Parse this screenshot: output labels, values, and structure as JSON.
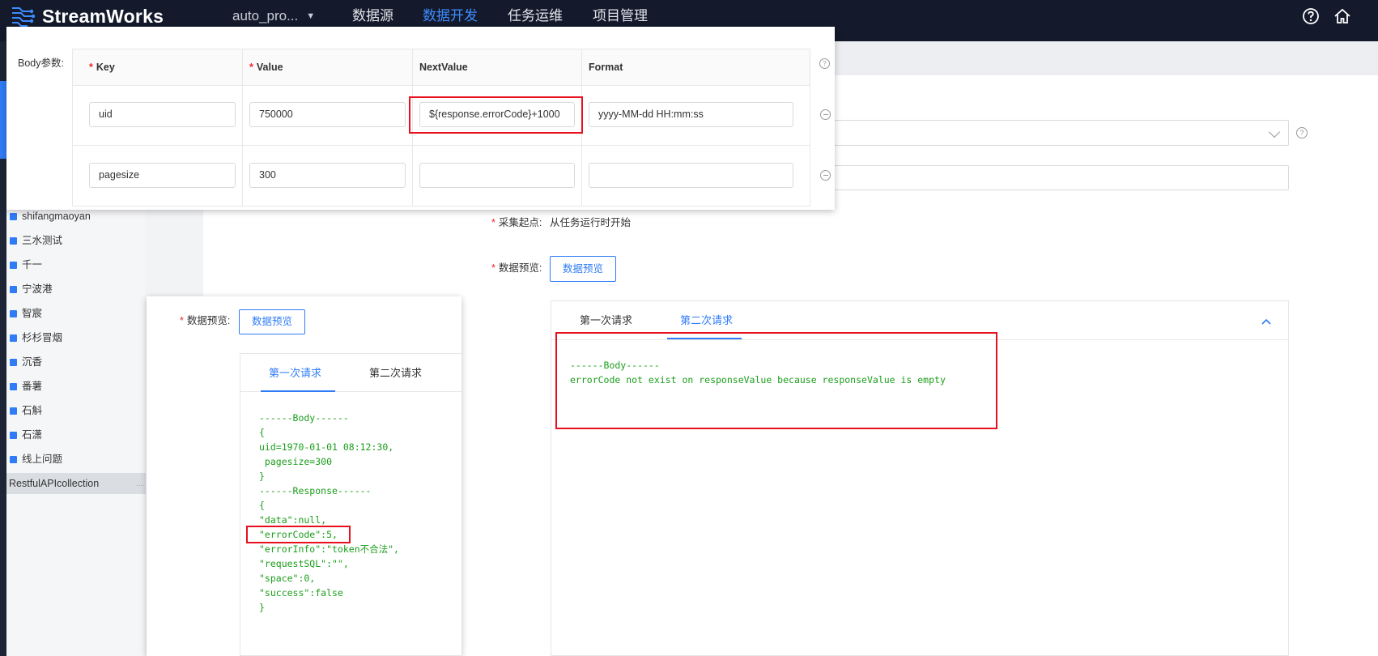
{
  "app": {
    "logo_text": "StreamWorks",
    "project": "auto_pro...",
    "nav": [
      "数据源",
      "数据开发",
      "任务运维",
      "项目管理"
    ],
    "active_nav": "数据开发"
  },
  "sidebar": {
    "items": [
      "shifangmaoyan",
      "三水测试",
      "千一",
      "宁波港",
      "智宸",
      "杉杉冒烟",
      "沉香",
      "番薯",
      "石斛",
      "石潇",
      "线上问题"
    ],
    "selected": "RestfulAPIcollection",
    "selected_more": "..."
  },
  "form": {
    "collect_start_label": "采集起点:",
    "collect_start_value": "从任务运行时开始",
    "preview_label": "数据预览:",
    "preview_button": "数据预览"
  },
  "right_preview": {
    "tabs": [
      "第一次请求",
      "第二次请求"
    ],
    "active_tab": 1,
    "lines": [
      "------Body------",
      "errorCode not exist on responseValue because responseValue is empty"
    ]
  },
  "left_preview": {
    "label": "数据预览:",
    "button": "数据预览",
    "tabs": [
      "第一次请求",
      "第二次请求"
    ],
    "active_tab": 0,
    "lines": [
      "------Body------",
      "{",
      "uid=1970-01-01 08:12:30,",
      " pagesize=300",
      "}",
      "------Response------",
      "{",
      "\"data\":null,",
      "\"errorCode\":5,",
      "\"errorInfo\":\"token不合法\",",
      "\"requestSQL\":\"\",",
      "\"space\":0,",
      "\"success\":false",
      "}"
    ]
  },
  "body_params": {
    "label": "Body参数:",
    "headers": {
      "key": "Key",
      "value": "Value",
      "next": "NextValue",
      "format": "Format"
    },
    "rows": [
      {
        "key": "uid",
        "value": "750000",
        "next": "${response.errorCode}+1000",
        "format": "yyyy-MM-dd HH:mm:ss"
      },
      {
        "key": "pagesize",
        "value": "300",
        "next": "",
        "format": ""
      }
    ]
  }
}
